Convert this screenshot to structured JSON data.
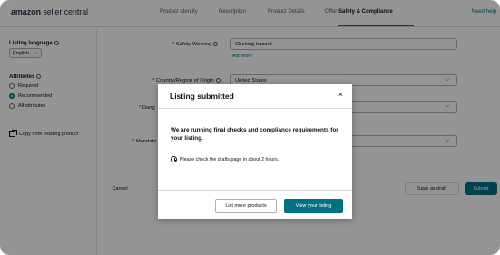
{
  "header": {
    "logo_brand": "amazon",
    "logo_rest": "seller central",
    "tabs": [
      {
        "label": "Product Identity"
      },
      {
        "label": "Description"
      },
      {
        "label": "Product Details"
      },
      {
        "label": "Offer"
      },
      {
        "label": "Safety & Compliance"
      }
    ],
    "active_tab": "Safety & Compliance",
    "help_link": "Need help"
  },
  "sidebar": {
    "listing_language_label": "Listing language",
    "listing_language_value": "English",
    "attributes_label": "Attributes",
    "attribute_options": [
      {
        "label": "Required",
        "checked": false
      },
      {
        "label": "Recommended",
        "checked": true
      },
      {
        "label": "All attributes",
        "checked": false
      }
    ],
    "copy_label": "Copy from existing product"
  },
  "form": {
    "safety_warning_label": "Safety Warning",
    "safety_warning_value": "Choking hazard",
    "add_more": "Add More",
    "country_label": "Country/Region of Origin",
    "country_value": "United States",
    "dangerous_label_partial": "Dang",
    "mandatory_label_partial": "Mandato",
    "cancel": "Cancel",
    "save_draft": "Save as draft",
    "submit": "Submit"
  },
  "modal": {
    "title": "Listing submitted",
    "close": "×",
    "body": "We are running final checks and compliance requirements for your listing.",
    "note": "Please check the drafts page in about 2 hours.",
    "list_more": "List more products",
    "view_listing": "View your listing"
  },
  "colors": {
    "accent": "#007185",
    "overlay": "rgba(0,0,0,0.42)",
    "required": "#c40000"
  },
  "icons": [
    "info-icon",
    "chevron-down-icon",
    "radio-icon",
    "copy-icon",
    "close-icon",
    "clock-icon"
  ]
}
